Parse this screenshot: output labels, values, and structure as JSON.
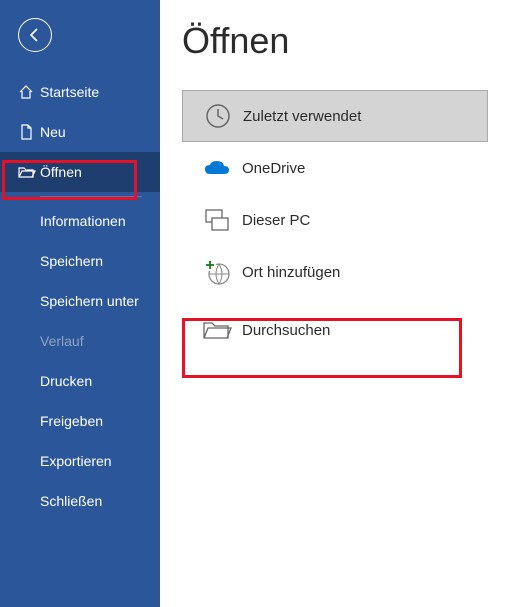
{
  "sidebar": {
    "startseite": "Startseite",
    "neu": "Neu",
    "oeffnen": "Öffnen",
    "informationen": "Informationen",
    "speichern": "Speichern",
    "speichern_unter": "Speichern unter",
    "verlauf": "Verlauf",
    "drucken": "Drucken",
    "freigeben": "Freigeben",
    "exportieren": "Exportieren",
    "schliessen": "Schließen"
  },
  "main": {
    "title": "Öffnen",
    "options": {
      "recent": "Zuletzt verwendet",
      "onedrive": "OneDrive",
      "thispc": "Dieser PC",
      "addplace": "Ort hinzufügen",
      "browse": "Durchsuchen"
    }
  }
}
